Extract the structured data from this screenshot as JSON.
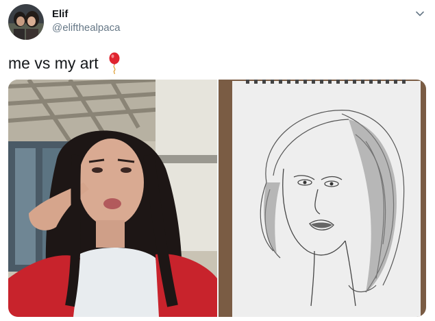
{
  "user": {
    "name": "Elif",
    "handle": "@elifthealpaca",
    "avatar_icon": "profile-photo-avatar"
  },
  "tweet": {
    "text": "me vs my art",
    "emoji_icon": "red-balloon-icon"
  },
  "media": {
    "left_image": "selfie-photo",
    "right_image": "pencil-sketch-on-notebook"
  },
  "icons": {
    "menu": "chevron-down-icon"
  },
  "colors": {
    "name": "#14171a",
    "handle": "#657786",
    "balloon": "#e0242f",
    "sweater": "#c8232c"
  }
}
